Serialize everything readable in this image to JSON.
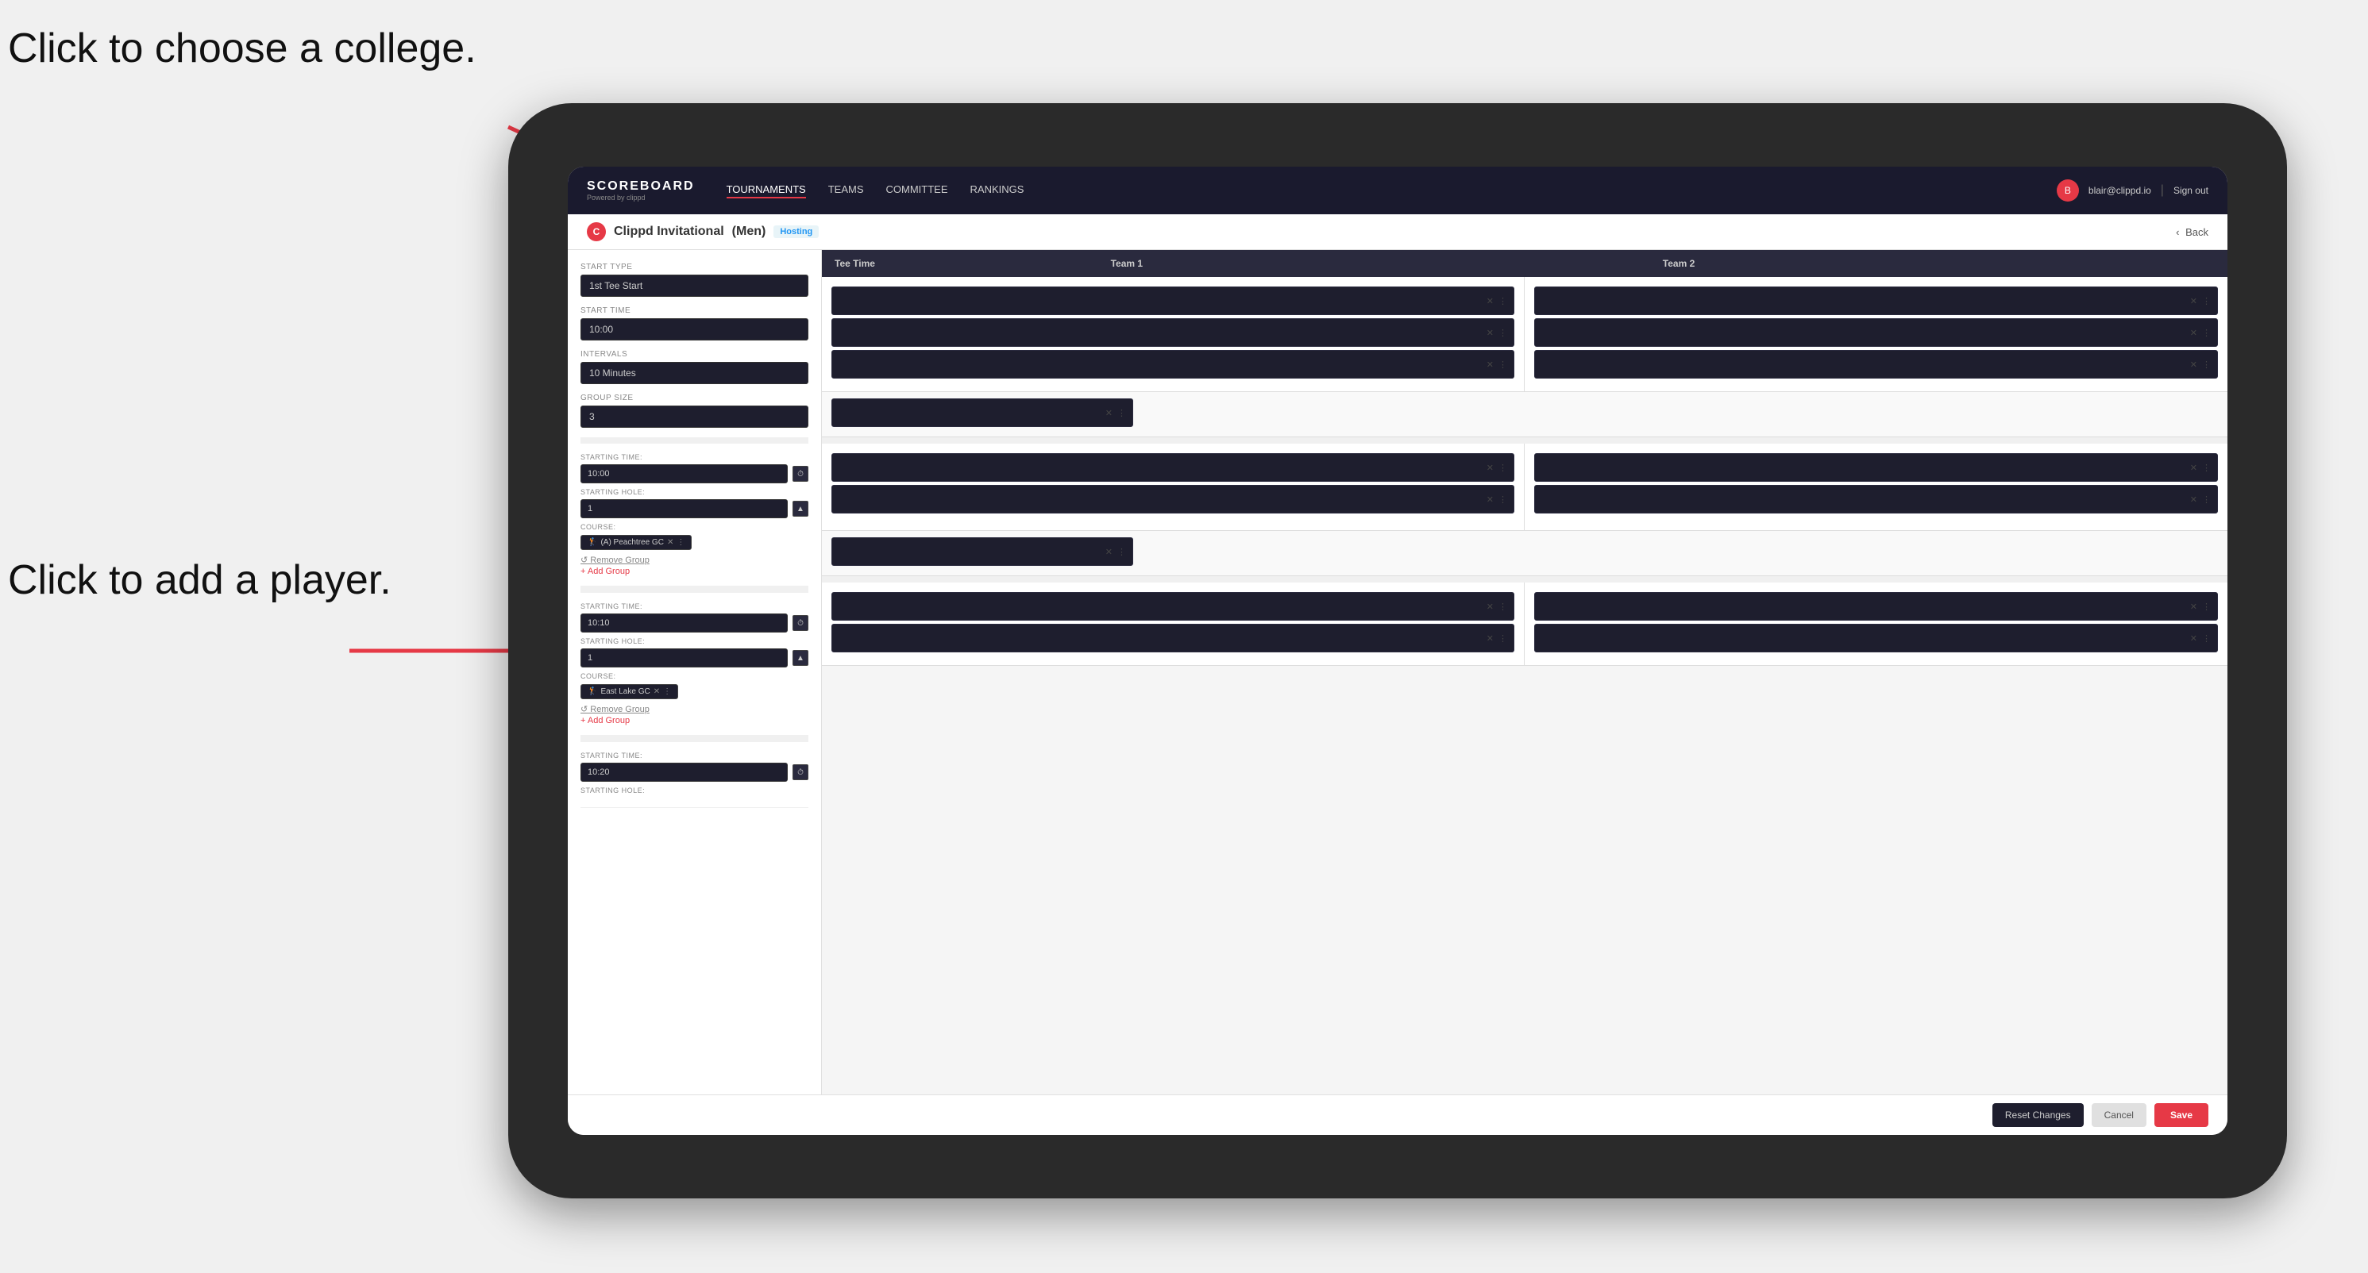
{
  "annotations": {
    "top_text": "Click to choose a college.",
    "bottom_text": "Click to add a player."
  },
  "navbar": {
    "logo": "SCOREBOARD",
    "logo_sub": "Powered by clippd",
    "links": [
      "TOURNAMENTS",
      "TEAMS",
      "COMMITTEE",
      "RANKINGS"
    ],
    "active_link": "TOURNAMENTS",
    "user_email": "blair@clippd.io",
    "sign_out": "Sign out"
  },
  "sub_header": {
    "tournament_name": "Clippd Invitational",
    "gender": "(Men)",
    "status": "Hosting",
    "back_label": "Back"
  },
  "settings": {
    "start_type_label": "Start Type",
    "start_type_value": "1st Tee Start",
    "start_time_label": "Start Time",
    "start_time_value": "10:00",
    "intervals_label": "Intervals",
    "intervals_value": "10 Minutes",
    "group_size_label": "Group Size",
    "group_size_value": "3"
  },
  "table": {
    "col_tee_time": "Tee Time",
    "col_team1": "Team 1",
    "col_team2": "Team 2"
  },
  "groups": [
    {
      "starting_time": "10:00",
      "starting_hole": "1",
      "course": "(A) Peachtree GC",
      "team1_slots": 3,
      "team2_slots": 3
    },
    {
      "starting_time": "10:10",
      "starting_hole": "1",
      "course": "East Lake GC",
      "team1_slots": 2,
      "team2_slots": 2
    },
    {
      "starting_time": "10:20",
      "starting_hole": "",
      "course": "",
      "team1_slots": 2,
      "team2_slots": 2
    }
  ],
  "footer": {
    "reset_label": "Reset Changes",
    "cancel_label": "Cancel",
    "save_label": "Save"
  }
}
